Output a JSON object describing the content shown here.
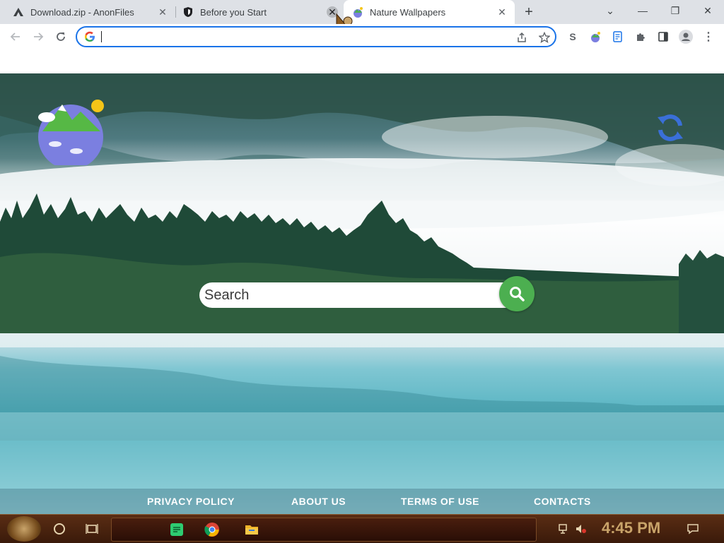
{
  "browser": {
    "tabs": [
      {
        "title": "Download.zip - AnonFiles",
        "favicon": "anonfiles-icon",
        "active": false
      },
      {
        "title": "Before you Start",
        "favicon": "shield-icon",
        "active": false
      },
      {
        "title": "Nature Wallpapers",
        "favicon": "nature-wallpapers-icon",
        "active": true
      }
    ],
    "new_tab_label": "+",
    "window_controls": {
      "tab_search": "⌄",
      "minimize": "—",
      "restore": "❐",
      "close": "✕"
    },
    "address_bar": {
      "value": "",
      "placeholder": ""
    }
  },
  "page": {
    "search": {
      "placeholder": "Search"
    },
    "footer_links": [
      "PRIVACY POLICY",
      "ABOUT US",
      "TERMS OF USE",
      "CONTACTS"
    ],
    "colors": {
      "search_button": "#4caf50",
      "omnibox_focus": "#1a73e8"
    }
  },
  "taskbar": {
    "clock": "4:45 PM"
  }
}
